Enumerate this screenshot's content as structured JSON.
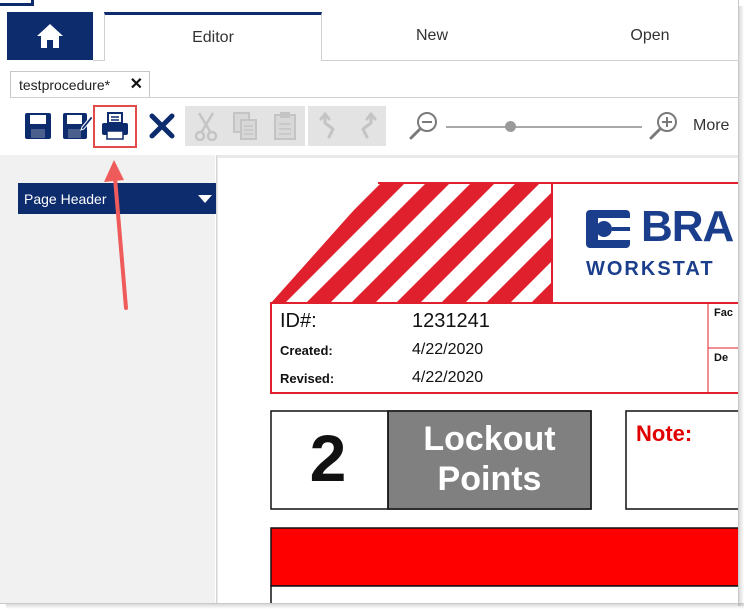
{
  "nav": {
    "tabs": [
      {
        "label": "Editor"
      },
      {
        "label": "New"
      },
      {
        "label": "Open"
      }
    ]
  },
  "document_tab": {
    "title": "testprocedure*",
    "close": "✕"
  },
  "toolbar": {
    "buttons": [
      "save-icon",
      "save-as-icon",
      "print-icon",
      "delete-icon",
      "cut-icon",
      "copy-icon",
      "paste-icon",
      "undo-icon",
      "redo-icon",
      "zoom-out-icon",
      "zoom-in-icon"
    ],
    "more_label": "More",
    "zoom_level": 0.33
  },
  "left_panel": {
    "section_label": "Page Header"
  },
  "procedure": {
    "logo_text": "BRA",
    "logo_sub": "WORKSTAT",
    "id_label": "ID#:",
    "id_value": "1231241",
    "created_label": "Created:",
    "created_value": "4/22/2020",
    "revised_label": "Revised:",
    "revised_value": "4/22/2020",
    "side_label_1": "Fac",
    "side_label_2": "De",
    "lockout_count": "2",
    "lockout_label_1": "Lockout",
    "lockout_label_2": "Points",
    "note_label": "Note:"
  },
  "colors": {
    "brand_blue": "#0d2c6e",
    "stripe_red": "#e0202c",
    "highlight_red": "#e34a4a",
    "lockout_gray": "#808080"
  }
}
